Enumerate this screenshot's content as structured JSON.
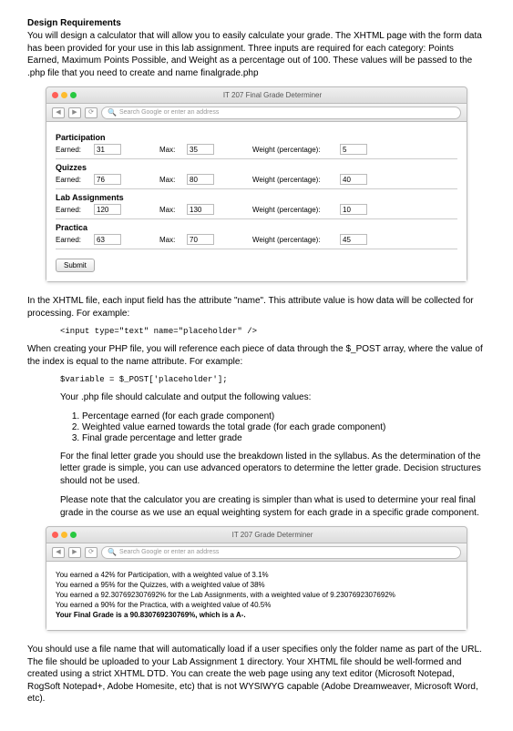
{
  "heading": "Design Requirements",
  "intro": "You will design a calculator that will allow you to easily calculate your grade.  The XHTML page with the form data has been provided for your use in this lab assignment.  Three inputs are required for each category: Points Earned, Maximum Points Possible, and Weight as a percentage out of 100.  These values will be passed to the .php file that you need to create and name finalgrade.php",
  "browser1": {
    "title": "IT 207 Final Grade Determiner",
    "addr_placeholder": "Search Google or enter an address",
    "sections": {
      "participation": {
        "h": "Participation",
        "earned_label": "Earned:",
        "earned": "31",
        "max_label": "Max:",
        "max": "35",
        "weight_label": "Weight (percentage):",
        "weight": "5"
      },
      "quizzes": {
        "h": "Quizzes",
        "earned_label": "Earned:",
        "earned": "76",
        "max_label": "Max:",
        "max": "80",
        "weight_label": "Weight (percentage):",
        "weight": "40"
      },
      "lab": {
        "h": "Lab Assignments",
        "earned_label": "Earned:",
        "earned": "120",
        "max_label": "Max:",
        "max": "130",
        "weight_label": "Weight (percentage):",
        "weight": "10"
      },
      "practica": {
        "h": "Practica",
        "earned_label": "Earned:",
        "earned": "63",
        "max_label": "Max:",
        "max": "70",
        "weight_label": "Weight (percentage):",
        "weight": "45"
      }
    },
    "submit": "Submit"
  },
  "p_name": "In the XHTML file, each input field has the attribute \"name\".  This attribute value is how data will be collected for processing.  For example:",
  "code1": "<input type=\"text\" name=\"placeholder\" />",
  "p_post": "When creating your PHP file, you will reference each piece of data through the $_POST array, where the value of the index is equal to the name attribute.  For example:",
  "code2": "$variable = $_POST['placeholder'];",
  "p_values_intro": "Your .php file should calculate and output the following values:",
  "values_list": [
    "Percentage earned (for each grade component)",
    "Weighted value earned towards the total grade (for each grade component)",
    "Final grade percentage and letter grade"
  ],
  "p_letter": "For the final letter grade you should use the breakdown listed in the syllabus.  As the determination of the letter grade is simple, you can use advanced operators to determine the letter grade.  Decision structures should not be used.",
  "p_note": "Please note that the calculator you are creating is simpler than what is used to determine your real final grade in the course as we use an equal weighting system for each grade in a specific grade component.",
  "browser2": {
    "title": "IT 207 Grade Determiner",
    "addr_placeholder": "Search Google or enter an address",
    "lines": [
      "You earned a 42% for Participation, with a weighted value of 3.1%",
      "You earned a 95% for the Quizzes, with a weighted value of 38%",
      "You earned a 92.307692307692% for the Lab Assignments, with a weighted value of 9.2307692307692%",
      "You earned a 90% for the Practica, with a weighted value of 40.5%"
    ],
    "final": "Your Final Grade is a 90.830769230769%, which is a A-."
  },
  "p_filename": "You should use a file name that will automatically load if a user specifies only the folder name as part of the URL.  The file should be uploaded to your Lab Assignment 1 directory.  Your XHTML file should be well-formed and created using a strict XHTML DTD.  You can create the web page using any text editor (Microsoft Notepad, RogSoft Notepad+, Adobe Homesite, etc) that is not WYSIWYG capable (Adobe Dreamweaver, Microsoft Word, etc)."
}
